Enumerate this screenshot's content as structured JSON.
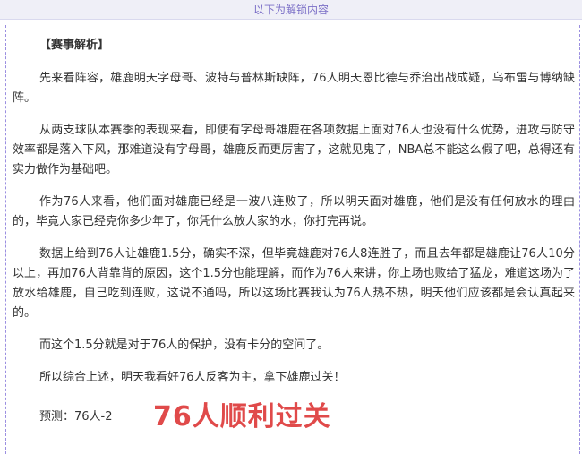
{
  "banner": {
    "text": "以下为解锁内容"
  },
  "article": {
    "section_title": "【赛事解析】",
    "paragraphs": [
      "先来看阵容，雄鹿明天字母哥、波特与普林斯缺阵，76人明天恩比德与乔治出战成疑，乌布雷与博纳缺阵。",
      "从两支球队本赛季的表现来看，即使有字母哥雄鹿在各项数据上面对76人也没有什么优势，进攻与防守效率都是落入下风，那难道没有字母哥，雄鹿反而更厉害了，这就见鬼了，NBA总不能这么假了吧，总得还有实力做作为基础吧。",
      "作为76人来看，他们面对雄鹿已经是一波八连败了，所以明天面对雄鹿，他们是没有任何放水的理由的，毕竟人家已经克你多少年了，你凭什么放人家的水，你打完再说。",
      "数据上给到76人让雄鹿1.5分，确实不深，但毕竟雄鹿对76人8连胜了，而且去年都是雄鹿让76人10分以上，再加76人背靠背的原因，这个1.5分也能理解，而作为76人来讲，你上场也败给了猛龙，难道这场为了放水给雄鹿，自己吃到连败，这说不通吗，所以这场比赛我认为76人热不热，明天他们应该都是会认真起来的。",
      "而这个1.5分就是对于76人的保护，没有卡分的空间了。",
      "所以综合上述，明天我看好76人反客为主，拿下雄鹿过关！"
    ],
    "prediction": "预测：76人-2",
    "verdict": "76人顺利过关"
  },
  "colors": {
    "banner_bg": "#efeff7",
    "banner_text": "#7b6fc7",
    "border_dash": "#9b8fe0",
    "body_text": "#333333",
    "verdict_red": "#e04a4a"
  }
}
